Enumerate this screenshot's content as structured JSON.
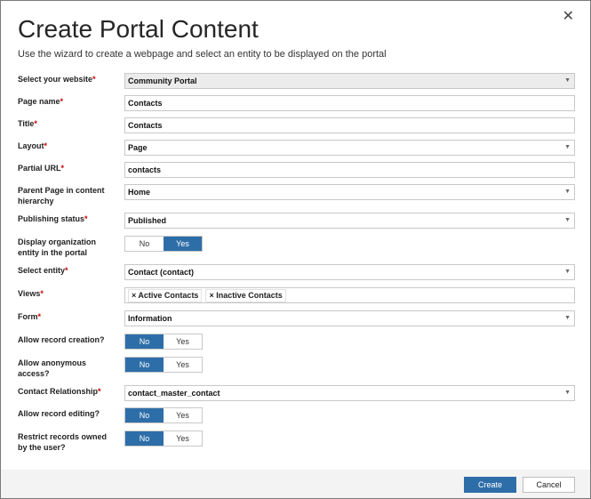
{
  "dialog": {
    "title": "Create Portal Content",
    "subtitle": "Use the wizard to create a webpage and select an entity to be displayed on the portal",
    "close_icon": "✕"
  },
  "form": {
    "required_mark": "*",
    "website": {
      "label": "Select your website",
      "value": "Community Portal"
    },
    "page_name": {
      "label": "Page name",
      "value": "Contacts"
    },
    "title": {
      "label": "Title",
      "value": "Contacts"
    },
    "layout": {
      "label": "Layout",
      "value": "Page"
    },
    "partial_url": {
      "label": "Partial URL",
      "value": "contacts"
    },
    "parent_page": {
      "label": "Parent Page in content hierarchy",
      "value": "Home"
    },
    "publishing_status": {
      "label": "Publishing status",
      "value": "Published"
    },
    "display_org": {
      "label": "Display organization entity in the portal",
      "no": "No",
      "yes": "Yes",
      "selected": "Yes"
    },
    "entity": {
      "label": "Select entity",
      "value": "Contact (contact)"
    },
    "views": {
      "label": "Views",
      "tags": [
        "× Active Contacts",
        "× Inactive Contacts"
      ]
    },
    "form_field": {
      "label": "Form",
      "value": "Information"
    },
    "allow_creation": {
      "label": "Allow record creation?",
      "no": "No",
      "yes": "Yes",
      "selected": "No"
    },
    "allow_anonymous": {
      "label": "Allow anonymous access?",
      "no": "No",
      "yes": "Yes",
      "selected": "No"
    },
    "contact_relationship": {
      "label": "Contact Relationship",
      "value": "contact_master_contact"
    },
    "allow_editing": {
      "label": "Allow record editing?",
      "no": "No",
      "yes": "Yes",
      "selected": "No"
    },
    "restrict_owned": {
      "label": "Restrict records owned by the user?",
      "no": "No",
      "yes": "Yes",
      "selected": "No"
    }
  },
  "footer": {
    "create_label": "Create",
    "cancel_label": "Cancel"
  },
  "colors": {
    "accent": "#2e6ea8",
    "required": "#cc0000"
  },
  "icons": {
    "dropdown": "chevron-down-icon",
    "close": "close-icon"
  }
}
